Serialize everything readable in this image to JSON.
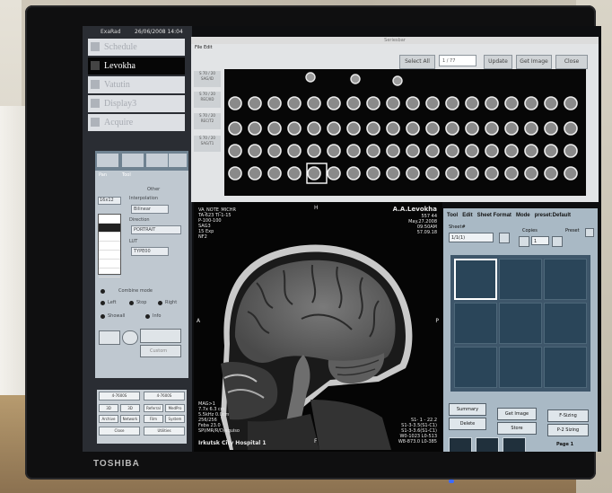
{
  "app": {
    "logo": "ExaRad",
    "datetime": "26/06/2008 14:04"
  },
  "sidebar": {
    "menu": [
      {
        "label": "Schedule",
        "active": false
      },
      {
        "label": "Levokha",
        "active": true
      },
      {
        "label": "Vatutin",
        "active": false
      },
      {
        "label": "Display3",
        "active": false
      },
      {
        "label": "Acquire",
        "active": false
      }
    ],
    "panel": {
      "tabs": [
        "Pan",
        "Tool"
      ],
      "labels": {
        "other": "Other",
        "interpolation": "Interpolation",
        "direction": "Direction",
        "lut": "LUT",
        "combine_mode": "Combine mode",
        "left": "Left",
        "stop": "Stop",
        "right": "Right",
        "show_all": "Showall",
        "info": "Info",
        "custom": "Custom"
      },
      "fields": {
        "layout": "16x12",
        "interp": "Bilinear",
        "direction": "PORTRAIT",
        "lut": "TYPE00"
      }
    },
    "bottom": {
      "cells": [
        "4-7600S",
        "4-7600S",
        "3D",
        "3D",
        "Referral",
        "MedPro",
        "Archive",
        "Network",
        "Film",
        "System",
        "Close",
        "Utilities"
      ]
    }
  },
  "strip_window": {
    "title": "Seriesbar",
    "menu": "File   Edit",
    "buttons": {
      "select_all": "Select All",
      "update": "Update",
      "get_image": "Get Image",
      "close": "Close"
    },
    "field": "1 / 77",
    "row_labels": [
      "S 70 / 20\nSAG/ID",
      "S 70 / 20\nREC/IID",
      "S 70 / 20\nREC/T2",
      "S 70 / 20\nSAG/T1"
    ]
  },
  "viewer": {
    "overlay_tl": [
      "VA_NOTE_MICHR",
      "TA-623 TI-1-15",
      "P-100-100",
      "SAG3",
      "15 Exp",
      "NF2"
    ],
    "overlay_tr": [
      "A.A.Levokha",
      "557 44",
      "May.27.2008",
      "09:50AM",
      "57.09.18"
    ],
    "overlay_bl": [
      "MAG>1",
      "7.7x 6.3 cm",
      "5.5kHz 0.0cm",
      "256/256",
      "Feba 23.0",
      "SPI/MR/R/D/aquiso"
    ],
    "overlay_br": [
      "S1- 1 - 22.2",
      "S1-3-3.5(S1-C1)",
      "S1-3-3.6(S1-C1)",
      "W0-1023 L0-513",
      "W8-873.0 L0-385"
    ],
    "orient_top": "H",
    "orient_left": "A",
    "orient_right": "P",
    "orient_bottom": "F",
    "hospital": "Irkutsk City Hospital 1"
  },
  "print_panel": {
    "menu": [
      "Tool",
      "Edit",
      "Sheet Format",
      "Mode",
      "preset:Default"
    ],
    "labels": {
      "sheet": "Sheet#",
      "copies": "Copies",
      "preset": "Preset"
    },
    "fields": {
      "sheet": "1/1(1)",
      "copies": "1"
    },
    "buttons": {
      "summary": "Summary",
      "delete": "Delete",
      "get_image": "Get Image",
      "store": "Store",
      "f_sizing": "F-Sizing",
      "p2_sizing": "P-2 Sizing",
      "page": "Page 1"
    }
  },
  "monitor": {
    "brand": "TOSHIBA"
  }
}
